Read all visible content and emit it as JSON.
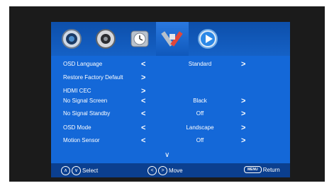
{
  "menu": {
    "items": [
      {
        "label": "OSD Language",
        "value": "Standard",
        "left": "<",
        "right": ">"
      },
      {
        "label": "Restore Factory Default",
        "value": "",
        "left": "",
        "right": ">"
      },
      {
        "label": "HDMI CEC",
        "value": "",
        "left": "",
        "right": ">"
      },
      {
        "label": "No Signal Screen",
        "value": "Black",
        "left": "<",
        "right": ">"
      },
      {
        "label": "No Signal Standby",
        "value": "Off",
        "left": "<",
        "right": ">"
      },
      {
        "label": "OSD Mode",
        "value": "Landscape",
        "left": "<",
        "right": ">"
      },
      {
        "label": "Motion Sensor",
        "value": "Off",
        "left": "<",
        "right": ">"
      }
    ],
    "more_indicator": "∨"
  },
  "footer": {
    "select_label": "Select",
    "move_label": "Move",
    "menu_key": "MENU",
    "return_label": "Return"
  },
  "icons": [
    "picture-icon",
    "speaker-icon",
    "clock-icon",
    "tools-icon",
    "play-icon"
  ]
}
